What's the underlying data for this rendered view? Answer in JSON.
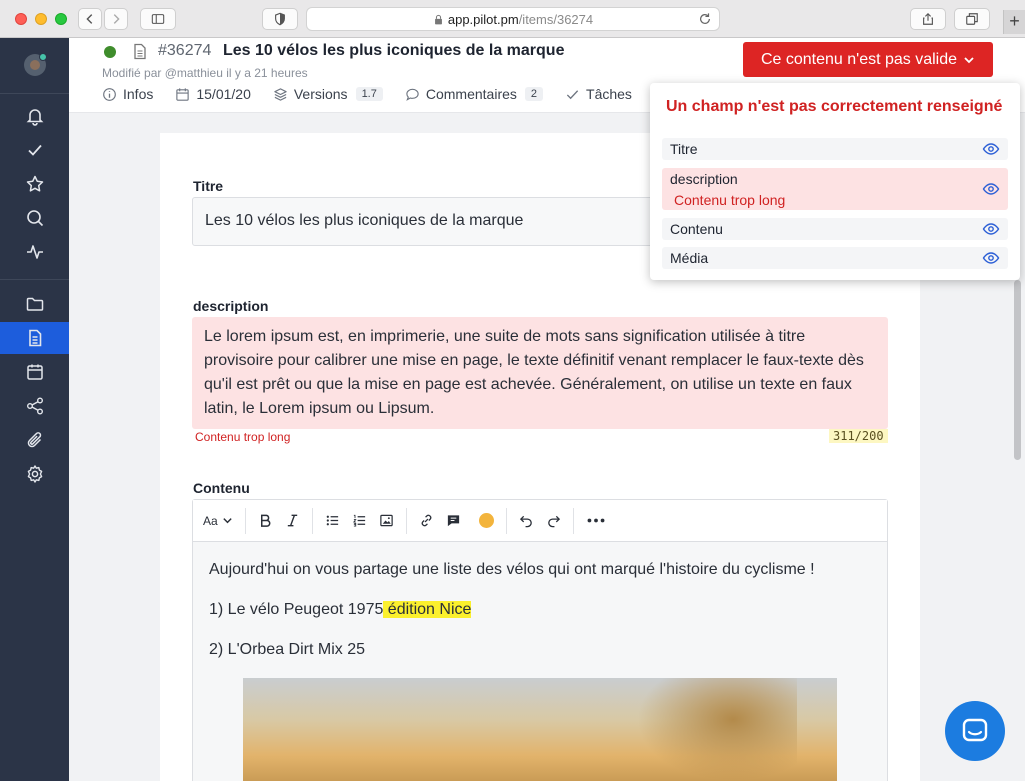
{
  "browser": {
    "url_host": "app.pilot.pm",
    "url_path": "/items/36274",
    "new_tab_label": "+"
  },
  "header": {
    "item_id": "#36274",
    "item_title": "Les 10 vélos les plus iconiques de la marque",
    "modified": "Modifié par @matthieu il y a 21 heures",
    "tabs": [
      {
        "label": "Infos"
      },
      {
        "label": "15/01/20"
      },
      {
        "label": "Versions",
        "count": "1.7"
      },
      {
        "label": "Commentaires",
        "count": "2"
      },
      {
        "label": "Tâches"
      }
    ],
    "invalid_button": "Ce contenu n'est pas valide"
  },
  "form": {
    "title_label": "Titre",
    "title_value": "Les 10 vélos les plus iconiques de la marque",
    "description_label": "description",
    "description_value": "Le lorem ipsum est, en imprimerie, une suite de mots sans signification utilisée à titre provisoire pour calibrer une mise en page, le texte définitif venant remplacer le faux-texte dès qu'il est prêt ou que la mise en page est achevée. Généralement, on utilise un texte en faux latin, le Lorem ipsum ou Lipsum.",
    "description_error": "Contenu trop long",
    "description_counter": "311/200",
    "content_label": "Contenu",
    "toolbar_font": "Aa",
    "content_line1": "Aujourd'hui on vous partage une liste des vélos qui ont marqué l'histoire du cyclisme !",
    "content_line2_prefix": "1) Le vélo Peugeot 1975",
    "content_line2_highlight": " édition Nice",
    "content_line3": "2) L'Orbea Dirt Mix 25"
  },
  "validation_panel": {
    "title": "Un champ n'est pas correctement renseigné",
    "items": [
      {
        "name": "Titre"
      },
      {
        "name": "description",
        "error": "Contenu trop long"
      },
      {
        "name": "Contenu"
      },
      {
        "name": "Média"
      }
    ]
  },
  "colors": {
    "sidebar": "#2b3447",
    "active": "#1d5ddc",
    "error": "#dd2524",
    "error_bg": "#fde2e3"
  }
}
